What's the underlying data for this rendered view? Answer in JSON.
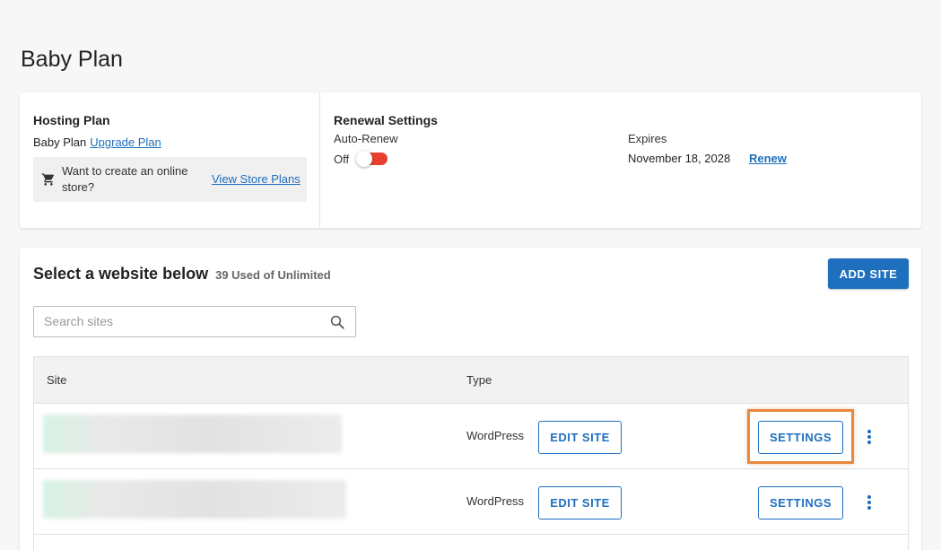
{
  "page": {
    "title": "Baby Plan"
  },
  "hosting": {
    "heading": "Hosting Plan",
    "plan_name": "Baby Plan",
    "upgrade_link": "Upgrade Plan",
    "store_prompt": "Want to create an online store?",
    "store_link": "View Store Plans",
    "store_icon": "shopping-cart-icon"
  },
  "renewal": {
    "heading": "Renewal Settings",
    "auto_renew_label": "Auto-Renew",
    "auto_renew_state": "Off",
    "expires_label": "Expires",
    "expires_date": "November 18, 2028",
    "renew_link": "Renew",
    "toggle_color": "#e8402f"
  },
  "sites": {
    "heading": "Select a website below",
    "used_count": "39 Used",
    "of_text": "of",
    "limit": "Unlimited",
    "add_button": "ADD SITE",
    "search_placeholder": "Search sites",
    "search_icon": "search-icon",
    "columns": {
      "site": "Site",
      "type": "Type"
    },
    "rows": [
      {
        "site_name": "",
        "type": "WordPress",
        "edit_label": "EDIT SITE",
        "settings_label": "SETTINGS",
        "highlighted": true
      },
      {
        "site_name": "",
        "type": "WordPress",
        "edit_label": "EDIT SITE",
        "settings_label": "SETTINGS",
        "highlighted": false
      }
    ]
  },
  "colors": {
    "accent": "#1f6fbf",
    "highlight": "#e8893f",
    "toggle_off": "#e8402f"
  }
}
